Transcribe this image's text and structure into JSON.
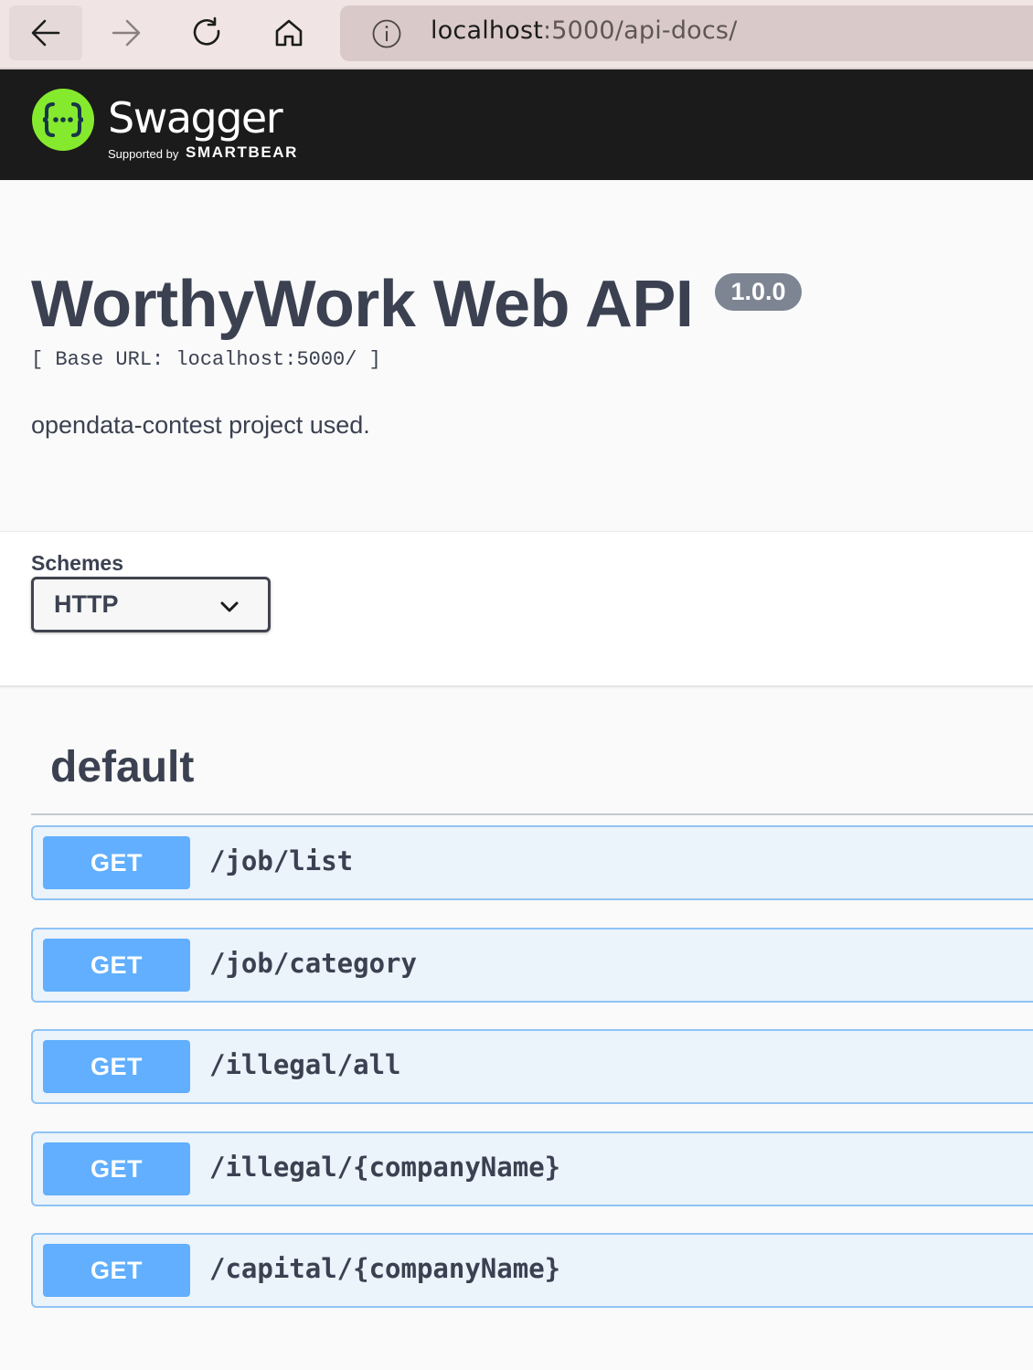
{
  "browser": {
    "url_host": "localhost",
    "url_path": ":5000/api-docs/"
  },
  "topbar": {
    "logo_title": "Swagger",
    "logo_tm": "™",
    "supported_by": "Supported by",
    "brand": "SMARTBEAR"
  },
  "info": {
    "title": "WorthyWork Web API",
    "version": "1.0.0",
    "base_url": "[ Base URL: localhost:5000/ ]",
    "description": "opendata-contest project used."
  },
  "schemes": {
    "label": "Schemes",
    "selected": "HTTP"
  },
  "tag": {
    "name": "default"
  },
  "operations": [
    {
      "method": "GET",
      "path": "/job/list"
    },
    {
      "method": "GET",
      "path": "/job/category"
    },
    {
      "method": "GET",
      "path": "/illegal/all"
    },
    {
      "method": "GET",
      "path": "/illegal/{companyName}"
    },
    {
      "method": "GET",
      "path": "/capital/{companyName}"
    }
  ],
  "colors": {
    "get_method": "#61affe",
    "get_background": "#ebf3fb",
    "topbar": "#1b1b1b",
    "logo_green": "#85ea2d",
    "text": "#3b4151"
  },
  "icons": {
    "back": "arrow-left-icon",
    "forward": "arrow-right-icon",
    "reload": "reload-icon",
    "home": "home-icon",
    "info": "info-icon",
    "logo": "swagger-logo-icon",
    "select": "chevron-down-icon"
  }
}
